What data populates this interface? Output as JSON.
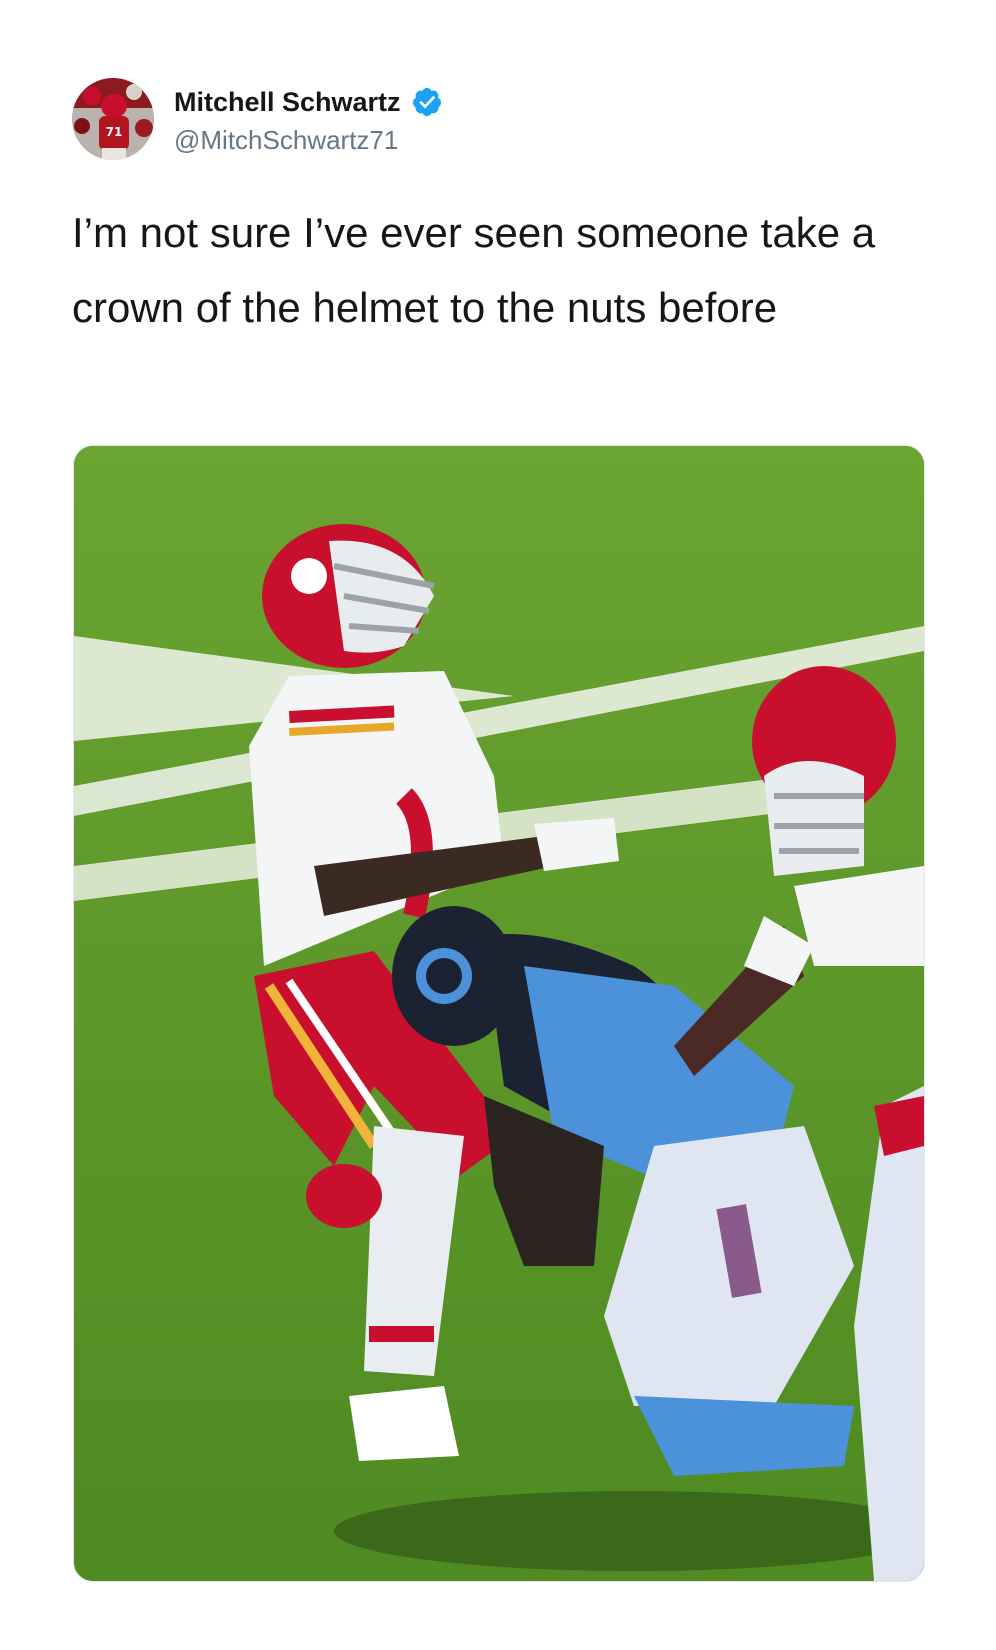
{
  "tweet": {
    "author": {
      "display_name": "Mitchell Schwartz",
      "handle": "@MitchSchwartz71",
      "verified": true,
      "avatar_icon": "profile-photo-avatar"
    },
    "text": "I’m not sure I’ve ever seen someone take a crown of the helmet to the nuts before",
    "media": {
      "type": "photo",
      "description_icon": "football-tackle-photo"
    }
  },
  "colors": {
    "text_primary": "#14171a",
    "text_secondary": "#657786",
    "verified_blue": "#1da1f2",
    "field_green": "#5f9a2c",
    "chiefs_red": "#c8102e",
    "titans_blue": "#4b92db"
  }
}
